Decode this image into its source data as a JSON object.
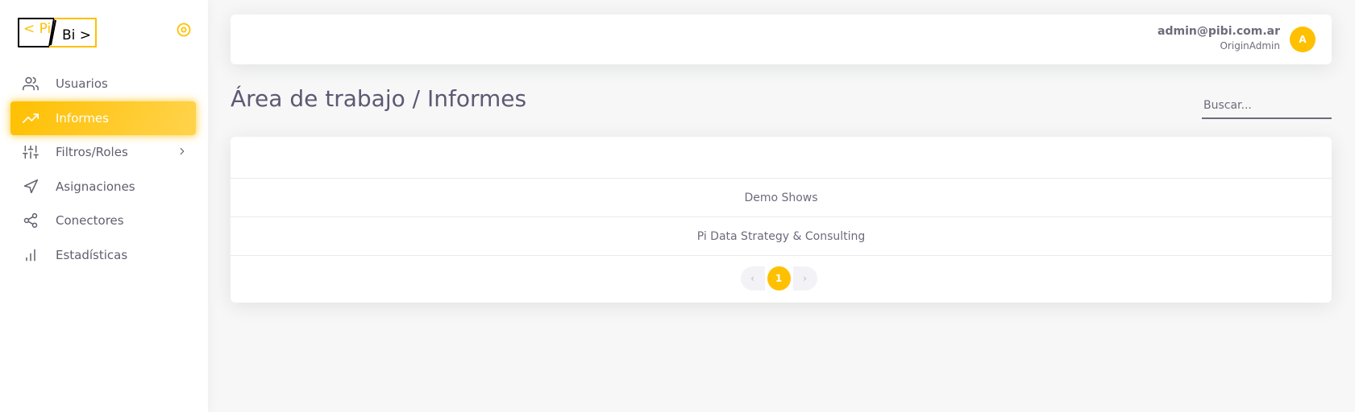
{
  "brand": {
    "logo_text_left": "< Pi",
    "logo_text_right": "Bi >",
    "accent": "#ffc001"
  },
  "sidebar": {
    "toggle_icon": "circle-dot-icon",
    "items": [
      {
        "label": "Usuarios",
        "icon": "users-icon",
        "active": false
      },
      {
        "label": "Informes",
        "icon": "trending-up-icon",
        "active": true
      },
      {
        "label": "Filtros/Roles",
        "icon": "sliders-icon",
        "active": false,
        "has_children": true
      },
      {
        "label": "Asignaciones",
        "icon": "navigation-icon",
        "active": false
      },
      {
        "label": "Conectores",
        "icon": "share-icon",
        "active": false
      },
      {
        "label": "Estadísticas",
        "icon": "bar-chart-icon",
        "active": false
      }
    ]
  },
  "header": {
    "user_email": "admin@pibi.com.ar",
    "user_role": "OriginAdmin",
    "avatar_initial": "A"
  },
  "main": {
    "title": "Área de trabajo / Informes",
    "search_placeholder": "Buscar...",
    "rows": [
      "Demo Shows",
      "Pi Data Strategy & Consulting"
    ],
    "pagination": {
      "prev": "‹",
      "current": "1",
      "next": "›"
    }
  }
}
